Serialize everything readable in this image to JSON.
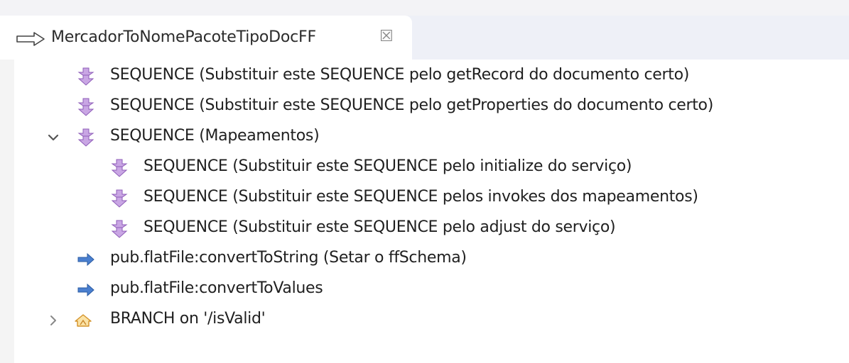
{
  "editor_tab": {
    "title": "MercadorToNomePacoteTipoDocFF",
    "close_glyph": "☒"
  },
  "tree": {
    "rows": [
      {
        "label": "SEQUENCE (Substituir este SEQUENCE pelo getRecord do documento certo)",
        "icon": "sequence-icon",
        "depth": 1
      },
      {
        "label": "SEQUENCE (Substituir este SEQUENCE pelo getProperties do documento certo)",
        "icon": "sequence-icon",
        "depth": 1
      },
      {
        "label": "SEQUENCE (Mapeamentos)",
        "icon": "sequence-icon",
        "depth": 1,
        "expanded": true
      },
      {
        "label": "SEQUENCE (Substituir este SEQUENCE pelo initialize do serviço)",
        "icon": "sequence-icon",
        "depth": 2
      },
      {
        "label": "SEQUENCE (Substituir este SEQUENCE pelos invokes dos mapeamentos)",
        "icon": "sequence-icon",
        "depth": 2
      },
      {
        "label": "SEQUENCE (Substituir este SEQUENCE pelo adjust do serviço)",
        "icon": "sequence-icon",
        "depth": 2
      },
      {
        "label": "pub.flatFile:convertToString (Setar o ffSchema)",
        "icon": "invoke-arrow-icon",
        "depth": 1
      },
      {
        "label": "pub.flatFile:convertToValues",
        "icon": "invoke-arrow-icon",
        "depth": 1
      },
      {
        "label": "BRANCH on '/isValid'",
        "icon": "branch-icon",
        "depth": 1,
        "expanded": false
      }
    ]
  },
  "colors": {
    "sequence": "#a675c9",
    "invoke": "#3f77c8",
    "branch": "#e0a23a",
    "twisty": "#555555"
  }
}
